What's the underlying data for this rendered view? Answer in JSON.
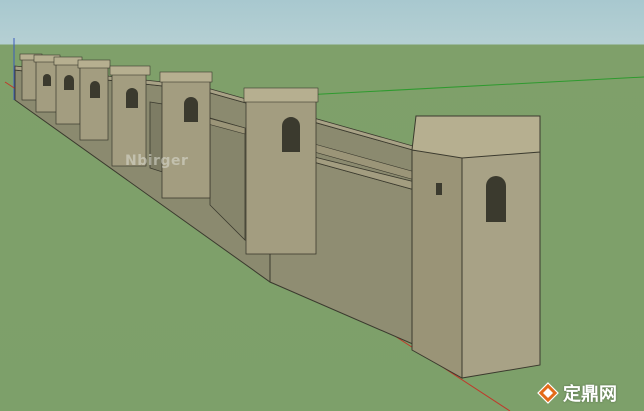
{
  "scene": {
    "subject": "castle-wall-3d-model",
    "colors": {
      "sky": "#b4cfd3",
      "ground": "#7da06a",
      "wall_face": "#8b8a6f",
      "wall_dark": "#6f6f58",
      "tower_face": "#a39d80",
      "tower_light": "#b6af90",
      "axis_red": "#c0392b",
      "axis_green": "#2e9a2e",
      "axis_blue": "#3b5bbd"
    }
  },
  "watermark": {
    "left_text": "Nbirger",
    "logo_text": "定鼎网",
    "logo_icon": "diamond-logo-icon"
  }
}
